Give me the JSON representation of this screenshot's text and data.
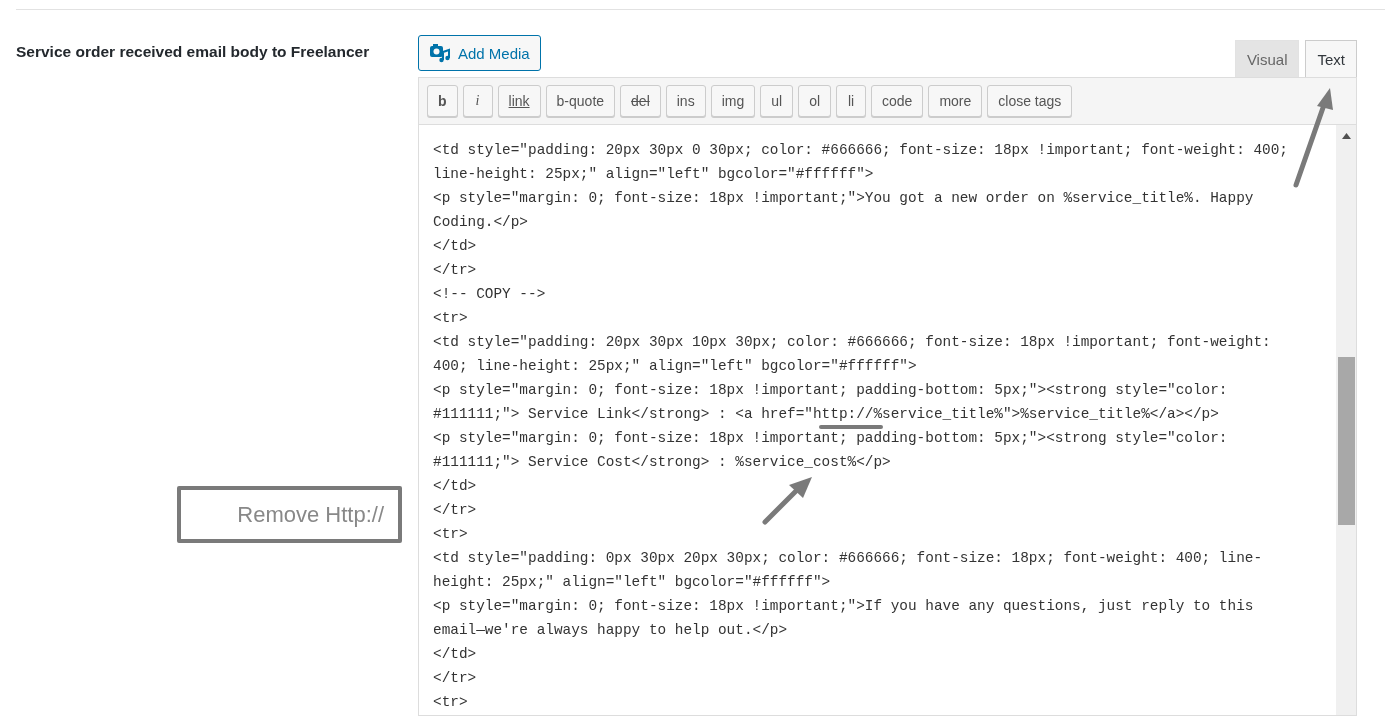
{
  "field_label": "Service order received email body to Freelancer",
  "add_media": {
    "label": "Add Media"
  },
  "editor_tabs": [
    {
      "label": "Visual",
      "selected": false
    },
    {
      "label": "Text",
      "selected": true
    }
  ],
  "toolbar": [
    {
      "label": "b",
      "kind": "bold"
    },
    {
      "label": "i",
      "kind": "italic"
    },
    {
      "label": "link",
      "kind": "underline"
    },
    {
      "label": "b-quote",
      "kind": "plain"
    },
    {
      "label": "del",
      "kind": "strike"
    },
    {
      "label": "ins",
      "kind": "plain"
    },
    {
      "label": "img",
      "kind": "plain"
    },
    {
      "label": "ul",
      "kind": "plain"
    },
    {
      "label": "ol",
      "kind": "plain"
    },
    {
      "label": "li",
      "kind": "plain"
    },
    {
      "label": "code",
      "kind": "plain"
    },
    {
      "label": "more",
      "kind": "plain"
    },
    {
      "label": "close tags",
      "kind": "plain"
    }
  ],
  "code_lines": [
    "<td style=\"padding: 20px 30px 0 30px; color: #666666; font-size: 18px !important; font-weight: 400;",
    "line-height: 25px;\" align=\"left\" bgcolor=\"#ffffff\">",
    "<p style=\"margin: 0; font-size: 18px !important;\">You got a new order on %service_title%. Happy",
    "Coding.</p>",
    "</td>",
    "</tr>",
    "<!-- COPY -->",
    "<tr>",
    "<td style=\"padding: 20px 30px 10px 30px; color: #666666; font-size: 18px !important; font-weight:",
    "400; line-height: 25px;\" align=\"left\" bgcolor=\"#ffffff\">",
    "<p style=\"margin: 0; font-size: 18px !important; padding-bottom: 5px;\"><strong style=\"color:",
    "#111111;\"> Service Link</strong> : <a href=\"http://%service_title%\">%service_title%</a></p>",
    "<p style=\"margin: 0; font-size: 18px !important; padding-bottom: 5px;\"><strong style=\"color:",
    "#111111;\"> Service Cost</strong> : %service_cost%</p>",
    "</td>",
    "</tr>",
    "<tr>",
    "<td style=\"padding: 0px 30px 20px 30px; color: #666666; font-size: 18px; font-weight: 400; line-",
    "height: 25px;\" align=\"left\" bgcolor=\"#ffffff\">",
    "<p style=\"margin: 0; font-size: 18px !important;\">If you have any questions, just reply to this",
    "email—we're always happy to help out.</p>",
    "</td>",
    "</tr>",
    "<tr>"
  ],
  "annotation": {
    "text": "Remove Http://"
  }
}
